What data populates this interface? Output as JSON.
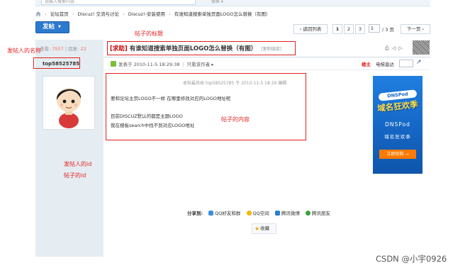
{
  "search": {
    "placeholder": "请输入搜索内容",
    "type_label": "搜索 ▾"
  },
  "breadcrumb": {
    "items": [
      "论坛首页",
      "Discuz! 交流与讨论",
      "Discuz!-安装使用",
      "有谁知道搜索单独页面LOGO怎么替换（有图）"
    ]
  },
  "toolbar": {
    "post_label": "发帖",
    "back_label": "返回列表",
    "pages": [
      "1",
      "2",
      "3"
    ],
    "page_input_value": "1",
    "page_total": "/ 3 页",
    "next_label": "下一页"
  },
  "thread": {
    "views_label": "查看:",
    "views": "7557",
    "replies_label": "回复:",
    "replies": "22",
    "tag": "[求助]",
    "title": "有谁知道搜索单独页面LOGO怎么替换（有图）",
    "copy_link": "[复制链接]",
    "tools": "⎙ ◁ ▷"
  },
  "post": {
    "author": "top58525785",
    "posted_at": "发表于 2010-11-5 18:29:38",
    "only_author": "只看该作者",
    "floor": "楼主",
    "jump_label": "电梯直达",
    "edit_note": "本帖最后由 top58525785 于 2010-11-5 18:29 编辑",
    "line1": "要和论坛主页LOGO不一样 在哪里修改对应的LOGO地址呢",
    "line2": "目前DISCUZ默认的都是主题LOGO",
    "line3": "我在搜板search中找不到对应LOGO地址"
  },
  "ad": {
    "logo": "DNSPod",
    "headline": "域名狂欢季",
    "name": "DNSPod",
    "subtitle": "域名狂欢季",
    "cta": "立即抢购 →"
  },
  "share": {
    "label": "分享到:",
    "items": [
      "QQ好友和群",
      "QQ空间",
      "腾讯微博",
      "腾讯朋友"
    ],
    "favorite": "收藏"
  },
  "annotations": {
    "title_note": "帖子的标题",
    "author_note": "发帖人的名称",
    "content_note": "帖子的内容",
    "id_note_1": "发帖人的id",
    "id_note_2": "帖子的id"
  },
  "watermark": "CSDN @小宇0926",
  "colors": {
    "accent": "#2b7acd",
    "annotation": "#e22222",
    "sidebar": "#e5edf2",
    "tag": "#c30000"
  }
}
